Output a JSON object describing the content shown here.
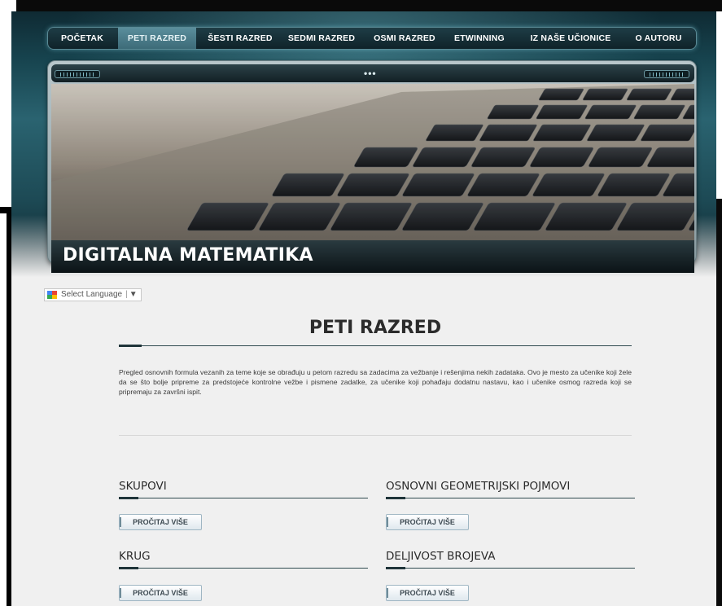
{
  "nav": {
    "items": [
      {
        "label": "POČETAK",
        "active": false
      },
      {
        "label": "PETI RAZRED",
        "active": true
      },
      {
        "label": "ŠESTI RAZRED",
        "active": false
      },
      {
        "label": "SEDMI RAZRED",
        "active": false
      },
      {
        "label": "OSMI RAZRED",
        "active": false
      },
      {
        "label": "ETWINNING",
        "active": false
      },
      {
        "label": "IZ NAŠE UČIONICE",
        "active": false
      },
      {
        "label": "O AUTORU",
        "active": false
      }
    ]
  },
  "banner": {
    "title": "DIGITALNA MATEMATIKA"
  },
  "language": {
    "label": "Select Language",
    "arrow": "▼"
  },
  "page": {
    "title": "PETI RAZRED",
    "intro": "Pregled osnovnih formula vezanih za teme koje se obrađuju u petom razredu sa zadacima za vežbanje i rešenjima nekih zadataka. Ovo je mesto za učenike koji žele da se što bolje pripreme za predstojeće kontrolne vežbe i pismene zadatke, za učenike koji pohađaju dodatnu nastavu, kao i učenike osmog razreda koji se pripremaju za završni ispit."
  },
  "topics": [
    {
      "title": "SKUPOVI",
      "button": "PROČITAJ VIŠE"
    },
    {
      "title": "OSNOVNI GEOMETRIJSKI POJMOVI",
      "button": "PROČITAJ VIŠE"
    },
    {
      "title": "KRUG",
      "button": "PROČITAJ VIŠE"
    },
    {
      "title": "DELJIVOST BROJEVA",
      "button": "PROČITAJ VIŠE"
    }
  ],
  "colors": {
    "header_teal": "#17444f",
    "active_tab": "#4f7f8c",
    "rule": "#2f4a50"
  }
}
